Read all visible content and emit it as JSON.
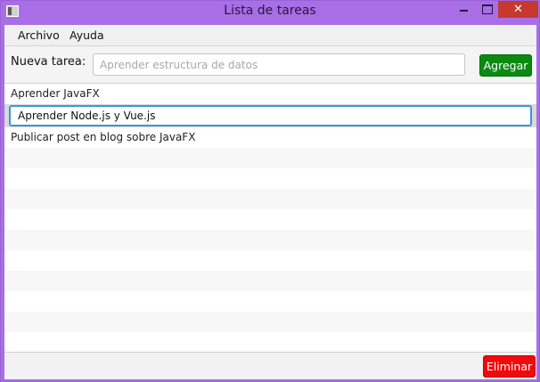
{
  "window": {
    "title": "Lista de tareas",
    "close_symbol": "✕",
    "icons": {
      "app": "app-window-icon",
      "minimize": "minimize-icon",
      "maximize": "maximize-icon",
      "close": "close-icon"
    },
    "accent_color": "#a86ee6"
  },
  "menu": {
    "items": [
      {
        "label": "Archivo"
      },
      {
        "label": "Ayuda"
      }
    ]
  },
  "toolbar": {
    "label": "Nueva tarea:",
    "input_placeholder": "Aprender estructura de datos",
    "input_value": "",
    "add_button": "Agregar",
    "add_button_color": "#0b8a12"
  },
  "tasks": {
    "items": [
      {
        "text": "Aprender JavaFX"
      },
      {
        "text": "Aprender Node.js y Vue.js",
        "editing": true
      },
      {
        "text": "Publicar post en blog sobre JavaFX"
      }
    ]
  },
  "footer": {
    "delete_button": "Eliminar",
    "delete_button_color": "#ef0b0b"
  }
}
